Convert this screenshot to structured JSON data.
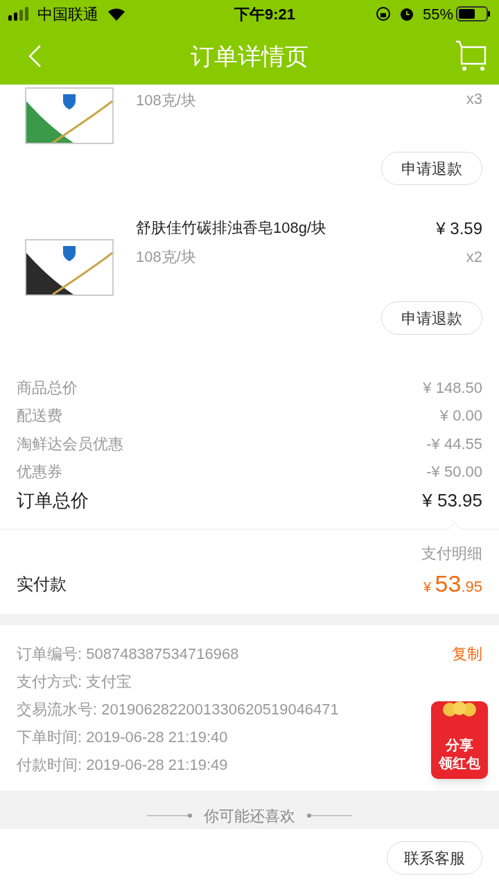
{
  "status_bar": {
    "carrier": "中国联通",
    "time": "下午9:21",
    "battery": "55%"
  },
  "nav": {
    "title": "订单详情页"
  },
  "items": [
    {
      "spec": "108克/块",
      "qty": "x3",
      "refund": "申请退款"
    },
    {
      "name": "舒肤佳竹碳排浊香皂108g/块",
      "price": "¥ 3.59",
      "spec": "108克/块",
      "qty": "x2",
      "refund": "申请退款"
    }
  ],
  "summary": [
    {
      "label": "商品总价",
      "value": "¥ 148.50"
    },
    {
      "label": "配送费",
      "value": "¥ 0.00"
    },
    {
      "label": "淘鲜达会员优惠",
      "value": "-¥ 44.55"
    },
    {
      "label": "优惠券",
      "value": "-¥ 50.00"
    }
  ],
  "total": {
    "label": "订单总价",
    "value": "¥ 53.95"
  },
  "payment": {
    "detail_link": "支付明细",
    "label": "实付款",
    "currency": "¥",
    "integer": "53",
    "decimal": ".95"
  },
  "info": {
    "rows": [
      "订单编号: 508748387534716968",
      "支付方式: 支付宝",
      "交易流水号: 2019062822001330620519046471",
      "下单时间: 2019-06-28 21:19:40",
      "付款时间: 2019-06-28 21:19:49"
    ],
    "copy": "复制"
  },
  "red_packet": {
    "line1": "分享",
    "line2": "领红包"
  },
  "recommend": {
    "title": "你可能还喜欢"
  },
  "bottom_bar": {
    "button": "联系客服"
  }
}
